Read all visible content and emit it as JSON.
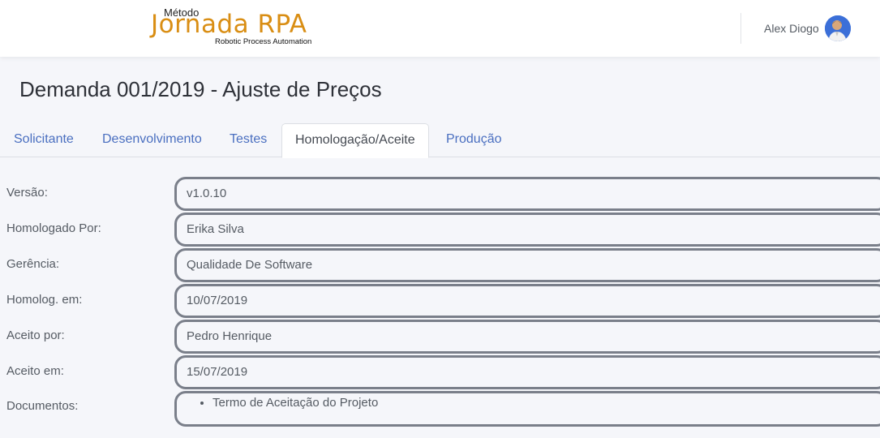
{
  "header": {
    "logo_top": "Método",
    "logo_main": "Jornada RPA",
    "logo_sub": "Robotic Process Automation",
    "user_name": "Alex Diogo",
    "accent_color": "#d98e14"
  },
  "page": {
    "title": "Demanda 001/2019 - Ajuste de Preços"
  },
  "tabs": [
    {
      "label": "Solicitante"
    },
    {
      "label": "Desenvolvimento"
    },
    {
      "label": "Testes"
    },
    {
      "label": "Homologação/Aceite"
    },
    {
      "label": "Produção"
    }
  ],
  "active_tab": "Homologação/Aceite",
  "form": {
    "version": {
      "label": "Versão:",
      "value": "v1.0.10"
    },
    "approved_by": {
      "label": "Homologado Por:",
      "value": "Erika Silva"
    },
    "management": {
      "label": "Gerência:",
      "value": "Qualidade De Software"
    },
    "approved_on": {
      "label": "Homolog. em:",
      "value": "10/07/2019"
    },
    "accepted_by": {
      "label": "Aceito por:",
      "value": "Pedro Henrique"
    },
    "accepted_on": {
      "label": "Aceito em:",
      "value": "15/07/2019"
    },
    "documents": {
      "label": "Documentos:",
      "items": [
        "Termo de Aceitação do Projeto"
      ]
    }
  }
}
